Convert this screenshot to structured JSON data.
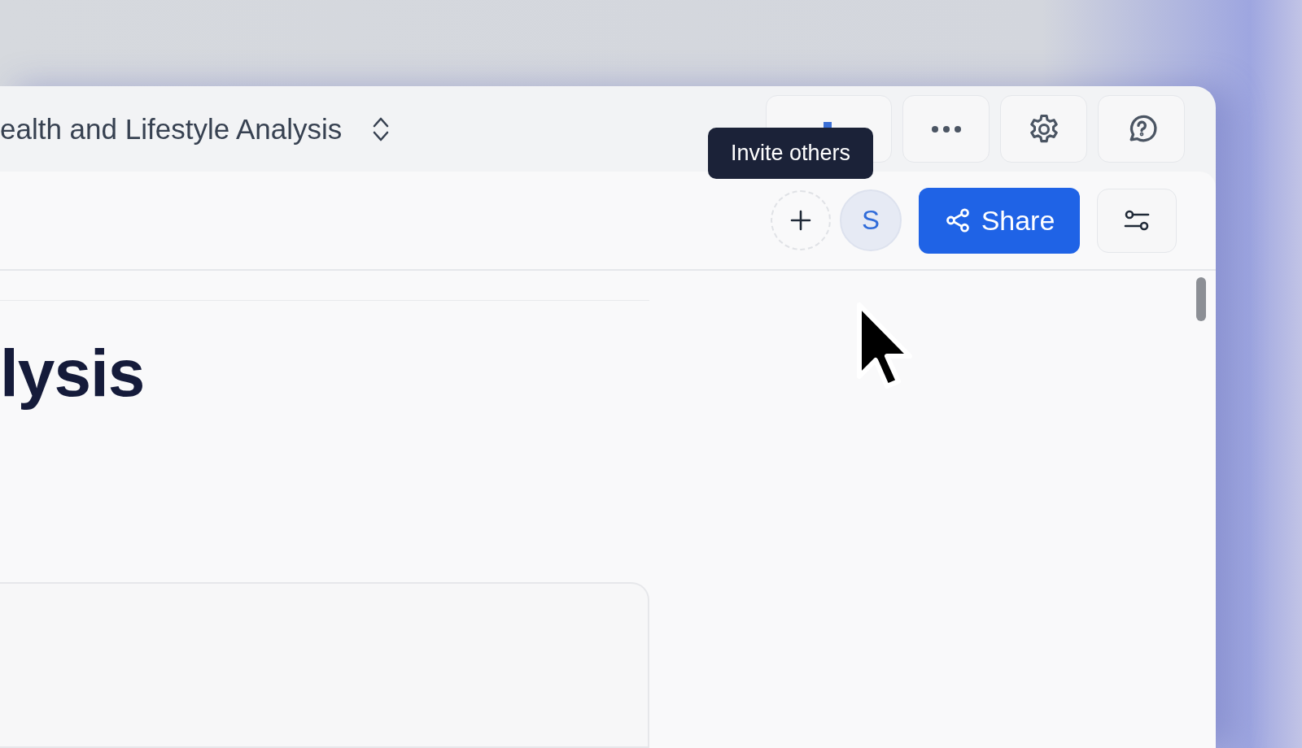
{
  "header": {
    "title": "ealth and Lifestyle Analysis"
  },
  "tooltip": {
    "text": "Invite others"
  },
  "collaborators": [
    {
      "initial": "S"
    }
  ],
  "share_button": {
    "label": "Share"
  },
  "document": {
    "heading": "lysis"
  }
}
